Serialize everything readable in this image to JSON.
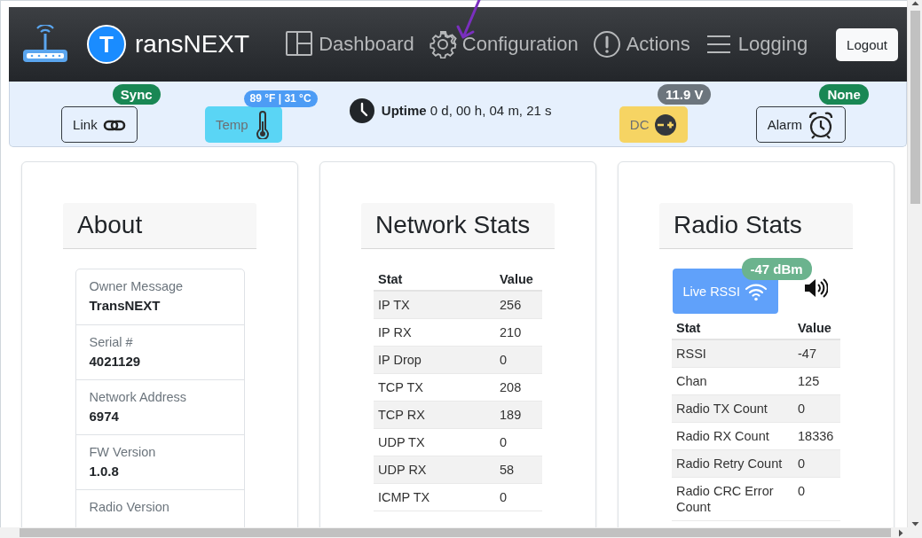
{
  "header": {
    "logo_letter": "T",
    "brand": "ransNEXT",
    "nav": [
      {
        "label": "Dashboard"
      },
      {
        "label": "Configuration"
      },
      {
        "label": "Actions"
      },
      {
        "label": "Logging"
      }
    ],
    "logout": "Logout"
  },
  "status": {
    "items": [
      {
        "kind": "outline",
        "label": "Link",
        "badge": {
          "text": "Sync",
          "color": "#198754"
        }
      },
      {
        "kind": "filled",
        "label": "Temp",
        "color": "#5ad5f5",
        "badge": {
          "text": "89 °F | 31 °C",
          "color": "#4d9cf5"
        }
      },
      {
        "kind": "uptime",
        "label": "Uptime",
        "value": "0 d, 00 h, 04 m, 21 s"
      },
      {
        "kind": "filled",
        "label": "DC",
        "color": "#f6d463",
        "badge": {
          "text": "11.9 V",
          "color": "#6c757d"
        }
      },
      {
        "kind": "outline",
        "label": "Alarm",
        "badge": {
          "text": "None",
          "color": "#198754"
        }
      }
    ]
  },
  "about": {
    "title": "About",
    "fields": [
      {
        "label": "Owner Message",
        "value": "TransNEXT"
      },
      {
        "label": "Serial #",
        "value": "4021129"
      },
      {
        "label": "Network Address",
        "value": "6974"
      },
      {
        "label": "FW Version",
        "value": "1.0.8"
      },
      {
        "label": "Radio Version"
      }
    ]
  },
  "network_stats": {
    "title": "Network Stats",
    "columns": [
      "Stat",
      "Value"
    ],
    "rows": [
      [
        "IP TX",
        "256"
      ],
      [
        "IP RX",
        "210"
      ],
      [
        "IP Drop",
        "0"
      ],
      [
        "TCP TX",
        "208"
      ],
      [
        "TCP RX",
        "189"
      ],
      [
        "UDP TX",
        "0"
      ],
      [
        "UDP RX",
        "58"
      ],
      [
        "ICMP TX",
        "0"
      ]
    ]
  },
  "radio_stats": {
    "title": "Radio Stats",
    "live_button": {
      "label": "Live RSSI",
      "badge": "-47 dBm"
    },
    "columns": [
      "Stat",
      "Value"
    ],
    "rows": [
      [
        "RSSI",
        "-47"
      ],
      [
        "Chan",
        "125"
      ],
      [
        "Radio TX Count",
        "0"
      ],
      [
        "Radio RX Count",
        "18336"
      ],
      [
        "Radio Retry Count",
        "0"
      ],
      [
        "Radio CRC Error Count",
        "0"
      ]
    ]
  }
}
